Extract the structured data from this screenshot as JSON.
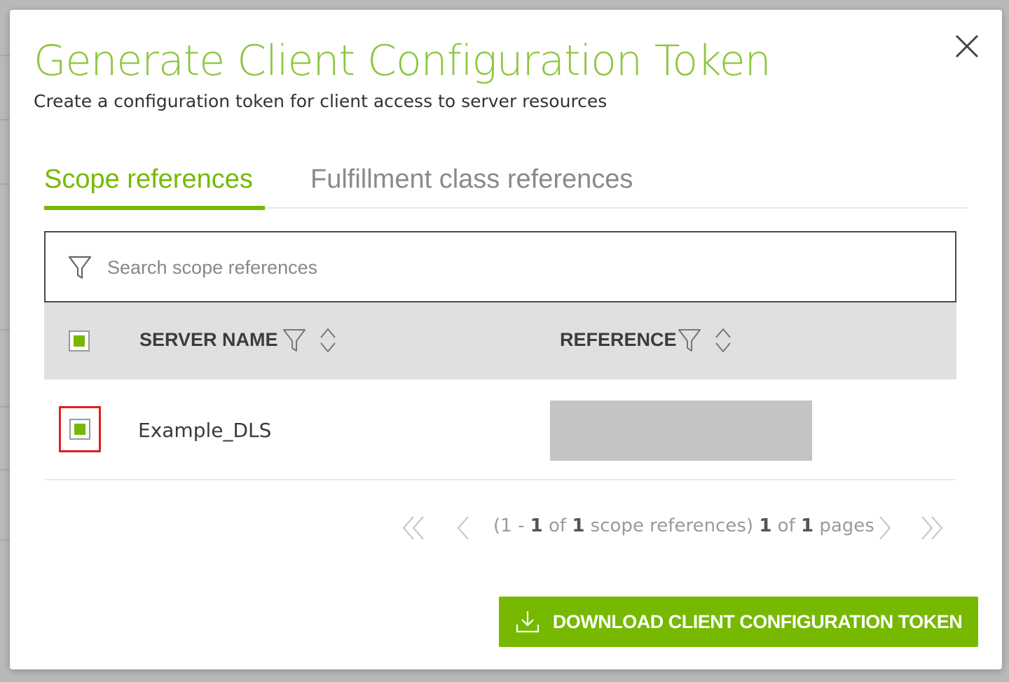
{
  "modal": {
    "title": "Generate Client Configuration Token",
    "subtitle": "Create a configuration token for client access to server resources"
  },
  "tabs": [
    {
      "label": "Scope references",
      "active": true
    },
    {
      "label": "Fulfillment class references",
      "active": false
    }
  ],
  "search": {
    "placeholder": "Search scope references",
    "value": ""
  },
  "table": {
    "columns": [
      "SERVER NAME",
      "REFERENCE"
    ],
    "select_all_checked": true,
    "rows": [
      {
        "checked": true,
        "server_name": "Example_DLS",
        "reference": ""
      }
    ]
  },
  "pagination": {
    "range_start": "1",
    "range_end": "1",
    "total": "1",
    "item_label": "scope references",
    "page": "1",
    "pages": "1",
    "pages_label": "pages"
  },
  "actions": {
    "download_label": "DOWNLOAD CLIENT CONFIGURATION TOKEN"
  },
  "colors": {
    "accent": "#76b900",
    "title_green": "#8cc63f",
    "highlight_border": "#e02020",
    "header_bg": "#e0e0e0"
  },
  "icons": [
    "close-icon",
    "filter-icon",
    "sort-icon",
    "first-page-icon",
    "prev-page-icon",
    "next-page-icon",
    "last-page-icon",
    "download-icon"
  ]
}
